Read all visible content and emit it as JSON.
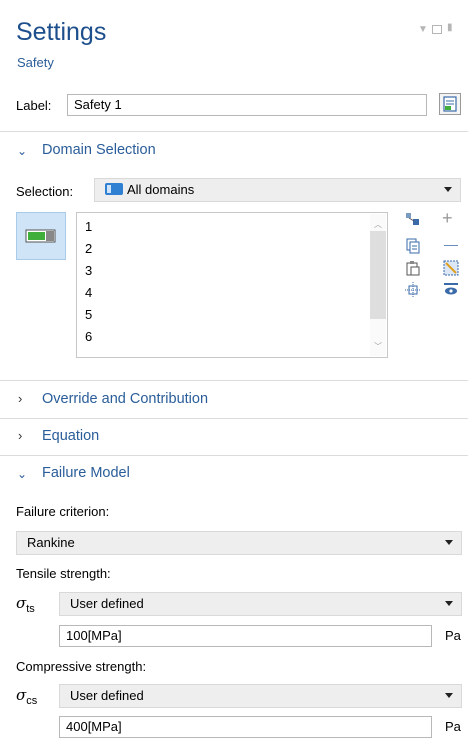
{
  "header": {
    "title": "Settings",
    "subtitle": "Safety"
  },
  "label_row": {
    "label": "Label:",
    "value": "Safety 1"
  },
  "domain_selection": {
    "heading": "Domain Selection",
    "selection_label": "Selection:",
    "selection_value": "All domains",
    "items": [
      "1",
      "2",
      "3",
      "4",
      "5",
      "6"
    ]
  },
  "sections": {
    "override": "Override and Contribution",
    "equation": "Equation",
    "failure_model": "Failure Model"
  },
  "failure_model": {
    "criterion_label": "Failure criterion:",
    "criterion_value": "Rankine",
    "tensile_label": "Tensile strength:",
    "tensile_symbol": "σ",
    "tensile_sub": "ts",
    "tensile_mode": "User defined",
    "tensile_value": "100[MPa]",
    "tensile_unit": "Pa",
    "compressive_label": "Compressive strength:",
    "compressive_symbol": "σ",
    "compressive_sub": "cs",
    "compressive_mode": "User defined",
    "compressive_value": "400[MPa]",
    "compressive_unit": "Pa"
  },
  "colors": {
    "accent": "#2a5d99",
    "title": "#1d4f8c",
    "toggle_active": "#3fae3a"
  },
  "icons": {
    "window_menu": "chevron-down-icon",
    "window_restore": "restore-icon",
    "window_pin": "pin-icon"
  }
}
